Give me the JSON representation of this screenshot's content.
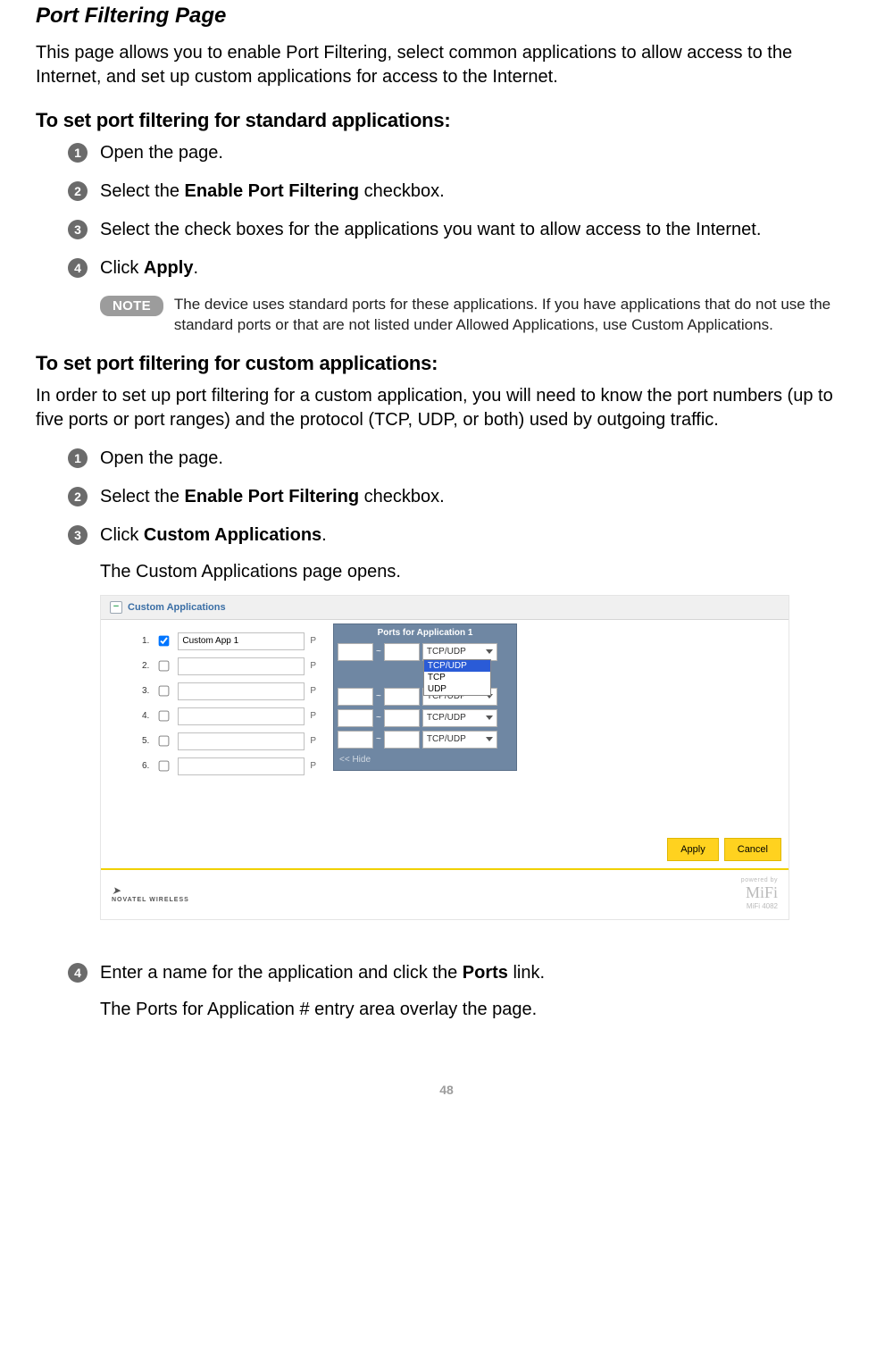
{
  "page_number": "48",
  "title": "Port Filtering Page",
  "intro": "This page allows you to enable Port Filtering, select common applications to allow access to the Internet, and set up custom applications for access to the Internet.",
  "section1": {
    "heading": "To set port filtering for standard applications:",
    "steps": [
      {
        "n": "1",
        "pre": "Open the page."
      },
      {
        "n": "2",
        "pre": "Select the ",
        "bold": "Enable Port Filtering",
        "post": " checkbox."
      },
      {
        "n": "3",
        "pre": "Select the check boxes for the applications you want to allow access to the Internet."
      },
      {
        "n": "4",
        "pre": "Click ",
        "bold": "Apply",
        "post": "."
      }
    ],
    "note_label": "NOTE",
    "note_text": "The device uses standard ports for these applications. If you have applications that do not use the standard ports or that are not listed under Allowed Applications, use Custom Applications."
  },
  "section2": {
    "heading": "To set port filtering for custom applications:",
    "intro": "In order to set up port filtering for a custom application, you will need to know the port numbers (up to five ports or port ranges) and the protocol (TCP, UDP, or both) used by outgoing traffic.",
    "steps": [
      {
        "n": "1",
        "pre": "Open the page."
      },
      {
        "n": "2",
        "pre": "Select the ",
        "bold": "Enable Port Filtering",
        "post": " checkbox."
      },
      {
        "n": "3",
        "pre": "Click ",
        "bold": "Custom Applications",
        "post": "."
      }
    ],
    "after3": "The Custom Applications page opens.",
    "step4": {
      "n": "4",
      "pre": "Enter a name for the application and click the ",
      "bold": "Ports",
      "post": " link."
    },
    "after4": "The Ports for Application # entry area overlay the page."
  },
  "screenshot": {
    "header": "Custom Applications",
    "apps": [
      {
        "num": "1.",
        "checked": true,
        "name": "Custom App 1"
      },
      {
        "num": "2.",
        "checked": false,
        "name": ""
      },
      {
        "num": "3.",
        "checked": false,
        "name": ""
      },
      {
        "num": "4.",
        "checked": false,
        "name": ""
      },
      {
        "num": "5.",
        "checked": false,
        "name": ""
      },
      {
        "num": "6.",
        "checked": false,
        "name": ""
      }
    ],
    "ports_panel_title": "Ports for Application 1",
    "proto_default": "TCP/UDP",
    "proto_options": [
      "TCP/UDP",
      "TCP",
      "UDP"
    ],
    "hide_label": "<< Hide",
    "apply": "Apply",
    "cancel": "Cancel",
    "powered_by": "powered by",
    "mifi": "MiFi",
    "mifi_model": "MiFi 4082",
    "novatel": "NOVATEL WIRELESS"
  }
}
